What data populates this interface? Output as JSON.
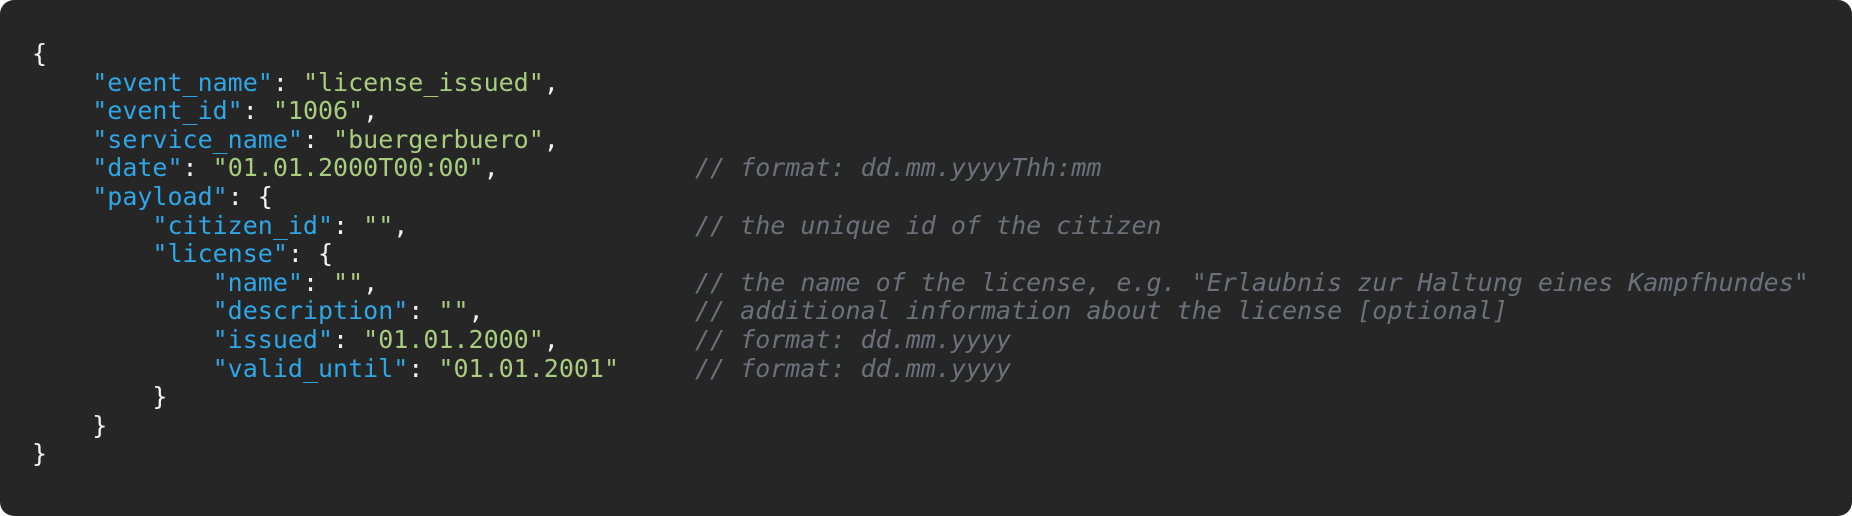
{
  "code_view": {
    "lines": [
      {
        "indent": "",
        "tokens": [
          {
            "type": "punct",
            "text": "{"
          }
        ],
        "comment": ""
      },
      {
        "indent": "    ",
        "tokens": [
          {
            "type": "key",
            "text": "\"event_name\""
          },
          {
            "type": "punct",
            "text": ": "
          },
          {
            "type": "string",
            "text": "\"license_issued\""
          },
          {
            "type": "punct",
            "text": ","
          }
        ],
        "comment": ""
      },
      {
        "indent": "    ",
        "tokens": [
          {
            "type": "key",
            "text": "\"event_id\""
          },
          {
            "type": "punct",
            "text": ": "
          },
          {
            "type": "string",
            "text": "\"1006\""
          },
          {
            "type": "punct",
            "text": ","
          }
        ],
        "comment": ""
      },
      {
        "indent": "    ",
        "tokens": [
          {
            "type": "key",
            "text": "\"service_name\""
          },
          {
            "type": "punct",
            "text": ": "
          },
          {
            "type": "string",
            "text": "\"buergerbuero\""
          },
          {
            "type": "punct",
            "text": ","
          }
        ],
        "comment": ""
      },
      {
        "indent": "    ",
        "tokens": [
          {
            "type": "key",
            "text": "\"date\""
          },
          {
            "type": "punct",
            "text": ": "
          },
          {
            "type": "string",
            "text": "\"01.01.2000T00:00\""
          },
          {
            "type": "punct",
            "text": ","
          }
        ],
        "comment": "// format: dd.mm.yyyyThh:mm"
      },
      {
        "indent": "    ",
        "tokens": [
          {
            "type": "key",
            "text": "\"payload\""
          },
          {
            "type": "punct",
            "text": ": {"
          }
        ],
        "comment": ""
      },
      {
        "indent": "        ",
        "tokens": [
          {
            "type": "key",
            "text": "\"citizen_id\""
          },
          {
            "type": "punct",
            "text": ": "
          },
          {
            "type": "string",
            "text": "\"\""
          },
          {
            "type": "punct",
            "text": ","
          }
        ],
        "comment": "// the unique id of the citizen"
      },
      {
        "indent": "        ",
        "tokens": [
          {
            "type": "key",
            "text": "\"license\""
          },
          {
            "type": "punct",
            "text": ": {"
          }
        ],
        "comment": ""
      },
      {
        "indent": "            ",
        "tokens": [
          {
            "type": "key",
            "text": "\"name\""
          },
          {
            "type": "punct",
            "text": ": "
          },
          {
            "type": "string",
            "text": "\"\""
          },
          {
            "type": "punct",
            "text": ","
          }
        ],
        "comment": "// the name of the license, e.g. \"Erlaubnis zur Haltung eines Kampfhundes\""
      },
      {
        "indent": "            ",
        "tokens": [
          {
            "type": "key",
            "text": "\"description\""
          },
          {
            "type": "punct",
            "text": ": "
          },
          {
            "type": "string",
            "text": "\"\""
          },
          {
            "type": "punct",
            "text": ","
          }
        ],
        "comment": "// additional information about the license [optional]"
      },
      {
        "indent": "            ",
        "tokens": [
          {
            "type": "key",
            "text": "\"issued\""
          },
          {
            "type": "punct",
            "text": ": "
          },
          {
            "type": "string",
            "text": "\"01.01.2000\""
          },
          {
            "type": "punct",
            "text": ","
          }
        ],
        "comment": "// format: dd.mm.yyyy"
      },
      {
        "indent": "            ",
        "tokens": [
          {
            "type": "key",
            "text": "\"valid_until\""
          },
          {
            "type": "punct",
            "text": ": "
          },
          {
            "type": "string",
            "text": "\"01.01.2001\""
          }
        ],
        "comment": "// format: dd.mm.yyyy"
      },
      {
        "indent": "        ",
        "tokens": [
          {
            "type": "punct",
            "text": "}"
          }
        ],
        "comment": ""
      },
      {
        "indent": "    ",
        "tokens": [
          {
            "type": "punct",
            "text": "}"
          }
        ],
        "comment": ""
      },
      {
        "indent": "",
        "tokens": [
          {
            "type": "punct",
            "text": "}"
          }
        ],
        "comment": ""
      }
    ]
  },
  "colors": {
    "background": "#262626",
    "key": "#2fa6e6",
    "string": "#a8cd7e",
    "punctuation": "#f2f2f2",
    "comment": "#6b717b"
  }
}
